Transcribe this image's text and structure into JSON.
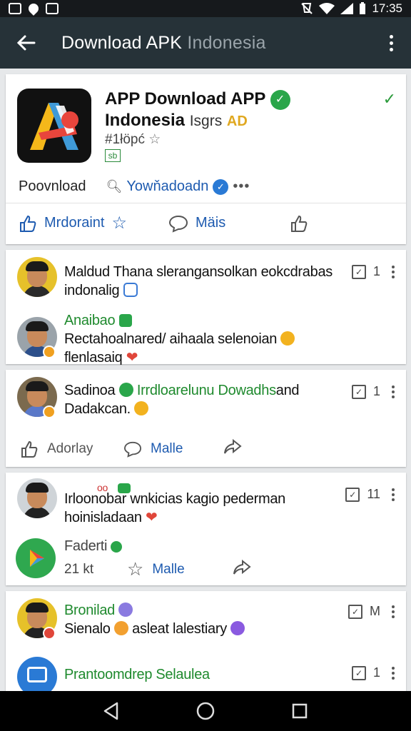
{
  "status_bar": {
    "time": "17:35"
  },
  "app_bar": {
    "title_main": "Download APK ",
    "title_fade": "Indonesia"
  },
  "hero": {
    "title_line1": "APP Download APP",
    "title_line2": "Indonesia",
    "title_suffix": "Isgrs",
    "title_badge": "AD",
    "meta": "#1łöpć",
    "mini_badge": "sb",
    "download_label": "Poovnload",
    "download_link": "Yowňadoadn",
    "actions": {
      "left": "Mrdoraint",
      "middle": "Mäis"
    }
  },
  "posts": [
    {
      "text_line1": "Maldud Thana slerangansolkan eokcdrabas",
      "text_line2": "indonalig",
      "count": "1",
      "reply_name": "Anaibao",
      "reply_line1": "Rectahoalnared/ aihaala selenoian",
      "reply_line2": "flenlasaiq"
    },
    {
      "name": "Sadinoa",
      "name_green": "Irrdloarelunu Dowadhs",
      "name_tail": "and",
      "text_line2": "Dadakcan.",
      "count": "1",
      "actions": {
        "left": "Adorlay",
        "middle": "Malle"
      }
    },
    {
      "top_label": "oo",
      "text_line1": "Irloonobar wnkicias kagio pederman",
      "text_line2": "hoinisladaan",
      "count": "11",
      "sub_name": "Faderti",
      "sub_count": "21 kt",
      "sub_action": "Malle"
    },
    {
      "name": "Bronilad",
      "text_line1": "Sienalo",
      "text_line1b": "asleat lalestiary",
      "count": "M",
      "reply_name": "Prantoomdrep Selaulea",
      "reply_count": "1"
    }
  ],
  "colors": {
    "app_bar": "#263238",
    "accent_blue": "#1e5bb0",
    "accent_green": "#1f8a2e",
    "badge_green": "#2aa64a"
  }
}
